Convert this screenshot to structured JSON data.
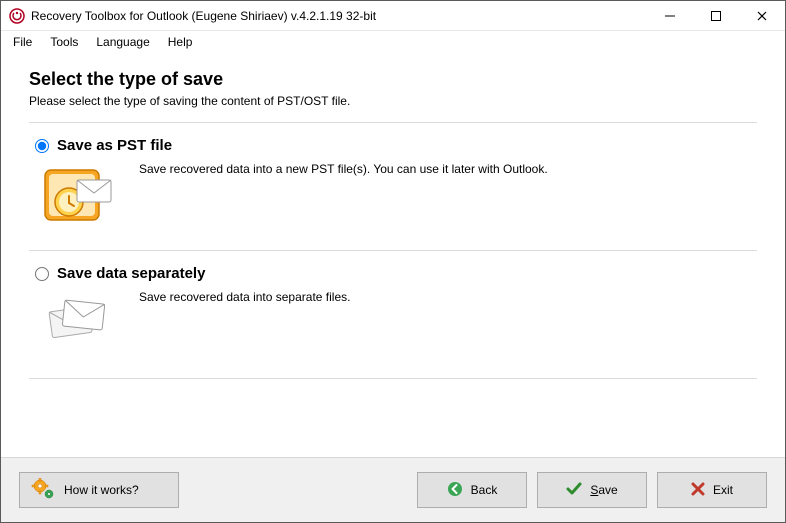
{
  "window": {
    "title": "Recovery Toolbox for Outlook (Eugene Shiriaev) v.4.2.1.19 32-bit"
  },
  "menu": {
    "file": "File",
    "tools": "Tools",
    "language": "Language",
    "help": "Help"
  },
  "page": {
    "title": "Select the type of save",
    "subtitle": "Please select the type of saving the content of PST/OST file."
  },
  "options": [
    {
      "label": "Save as PST file",
      "description": "Save recovered data into a new PST file(s). You can use it later with Outlook.",
      "selected": true
    },
    {
      "label": "Save data separately",
      "description": "Save recovered data into separate files.",
      "selected": false
    }
  ],
  "footer": {
    "howitworks": "How it works?",
    "back": "Back",
    "save_prefix": "S",
    "save_rest": "ave",
    "exit": "Exit"
  }
}
